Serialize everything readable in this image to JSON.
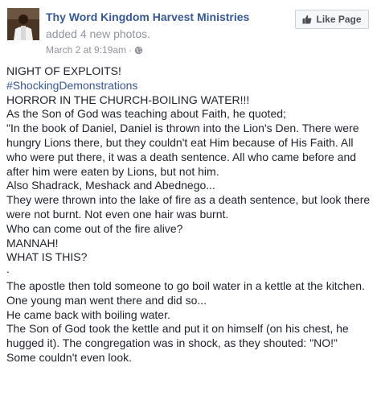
{
  "page": {
    "name": "Thy Word Kingdom Harvest Ministries",
    "action_text": "added",
    "photo_count_text": "4 new photos.",
    "timestamp": "March 2 at 9:19am",
    "separator": "·",
    "like_button_label": "Like Page"
  },
  "icons": {
    "avatar": "profile-photo",
    "privacy": "globe-icon",
    "like": "thumbs-up-icon"
  },
  "colors": {
    "link": "#365899",
    "muted": "#90949c",
    "text": "#1d2129"
  },
  "post": {
    "lines": [
      "NIGHT OF EXPLOITS!",
      "#ShockingDemonstrations",
      "HORROR IN THE CHURCH-BOILING WATER!!!",
      "As the Son of God was teaching about Faith, he quoted;",
      "\"In the book of Daniel, Daniel is thrown into the Lion's Den. There were",
      "hungry Lions there, but they couldn't eat Him because of His Faith. All",
      "who were put there, it was a death sentence. All who came before and",
      "after him were eaten by Lions, but not him.",
      "Also Shadrack, Meshack and Abednego...",
      "They were thrown into the lake of fire as a death sentence, but look there",
      "were not burnt. Not even one hair was burnt.",
      "Who can come out of the fire alive?",
      "MANNAH!",
      "WHAT IS THIS?",
      ".",
      "The apostle then told someone to go boil water in a kettle at the kitchen.",
      "One young man went there and did so...",
      "He came back with boiling water.",
      "The Son of God took the kettle and put it on himself (on his chest, he",
      "hugged it). The congregation was in shock, as they shouted: \"NO!\"",
      "Some couldn't even look."
    ]
  }
}
